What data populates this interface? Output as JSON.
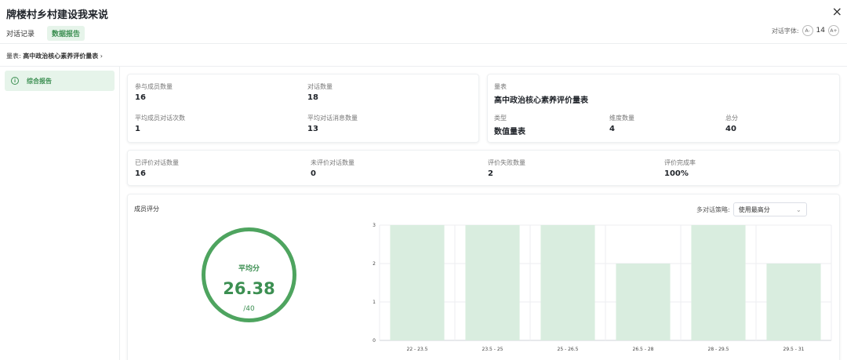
{
  "header": {
    "title": "牌楼村乡村建设我来说",
    "close": "×",
    "tabs": [
      "对话记录",
      "数据报告"
    ],
    "font_label": "对话字体:",
    "font_decrease": "A-",
    "font_size": "14",
    "font_increase": "A+"
  },
  "scale_line": {
    "label": "量表:",
    "name": "高中政治核心素养评价量表",
    "arrow": "›"
  },
  "sidebar": {
    "items": [
      {
        "label": "综合报告",
        "icon": "info-icon"
      }
    ]
  },
  "stats": {
    "participants_label": "参与成员数量",
    "participants": "16",
    "dialogs_label": "对话数量",
    "dialogs": "18",
    "avg_dialogs_label": "平均成员对话次数",
    "avg_dialogs": "1",
    "avg_messages_label": "平均对话消息数量",
    "avg_messages": "13"
  },
  "scale_card": {
    "scale_label": "量表",
    "scale_name": "高中政治核心素养评价量表",
    "type_label": "类型",
    "type": "数值量表",
    "dimensions_label": "维度数量",
    "dimensions": "4",
    "total_label": "总分",
    "total": "40"
  },
  "eval": {
    "evaluated_label": "已评价对话数量",
    "evaluated": "16",
    "unevaluated_label": "未评价对话数量",
    "unevaluated": "0",
    "failed_label": "评价失败数量",
    "failed": "2",
    "rate_label": "评价完成率",
    "rate": "100%"
  },
  "member_scores": {
    "title": "成员评分",
    "strategy_label": "多对话策略:",
    "strategy_value": "使用最高分",
    "avg_label": "平均分",
    "avg_value": "26.38",
    "avg_total": "/40"
  },
  "colors": {
    "accent": "#3c8f52",
    "bar": "#d9eddf",
    "ring": "#4ea45f"
  },
  "chart_data": {
    "type": "bar",
    "categories": [
      "22 - 23.5",
      "23.5 - 25",
      "25 - 26.5",
      "26.5 - 28",
      "28 - 29.5",
      "29.5 - 31"
    ],
    "values": [
      3,
      3,
      3,
      2,
      3,
      2
    ],
    "ylim": [
      0,
      3
    ],
    "yticks": [
      "0",
      "1",
      "2",
      "3"
    ],
    "grid": true
  }
}
